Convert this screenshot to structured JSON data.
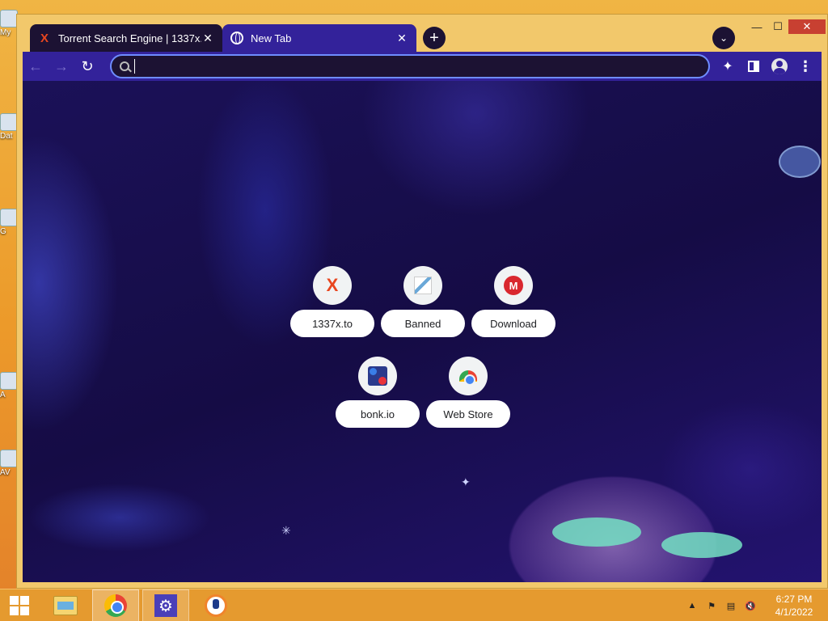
{
  "desktop": {
    "icons": [
      {
        "label": "My",
        "icon": "computer-icon"
      },
      {
        "label": "Dat",
        "icon": "document-icon"
      },
      {
        "label": "G",
        "icon": "app-icon"
      },
      {
        "label": "A",
        "icon": "app-icon"
      },
      {
        "label": "AV",
        "icon": "avast-icon"
      }
    ]
  },
  "browser": {
    "tabs": [
      {
        "title": "Torrent Search Engine | 1337x.to",
        "favicon": "1337x-x-icon",
        "active": false
      },
      {
        "title": "New Tab",
        "favicon": "globe-icon",
        "active": true
      }
    ],
    "new_tab_symbol": "+",
    "tab_search_symbol": "⌄",
    "window_controls": {
      "minimize": "—",
      "maximize": "☐",
      "close": "✕"
    },
    "toolbar": {
      "back": "←",
      "forward": "→",
      "reload": "↻",
      "address_value": "",
      "extensions_symbol": "✦",
      "menu_symbol": "⋮"
    },
    "colors": {
      "tab_active": "#33229a",
      "tab_inactive": "#1c1233",
      "frame": "#f2c86b",
      "omnibox_border": "#6e8cff"
    },
    "shortcuts": [
      {
        "label": "1337x.to",
        "icon": "1337x-x-icon"
      },
      {
        "label": "Banned",
        "icon": "banned-icon"
      },
      {
        "label": "Download",
        "icon": "mega-icon"
      },
      {
        "label": "bonk.io",
        "icon": "bonk-icon"
      },
      {
        "label": "Web Store",
        "icon": "chrome-web-store-icon"
      }
    ]
  },
  "taskbar": {
    "items": [
      {
        "name": "start",
        "icon": "windows-logo-icon"
      },
      {
        "name": "file-explorer",
        "icon": "folder-icon"
      },
      {
        "name": "chrome",
        "icon": "chrome-icon"
      },
      {
        "name": "settings",
        "icon": "gear-icon"
      },
      {
        "name": "avast",
        "icon": "avast-icon"
      }
    ],
    "tray": {
      "show_hidden": "▲",
      "flag": "⚑",
      "network": "▤",
      "volume": "🔇"
    },
    "clock": {
      "time": "6:27 PM",
      "date": "4/1/2022"
    }
  }
}
